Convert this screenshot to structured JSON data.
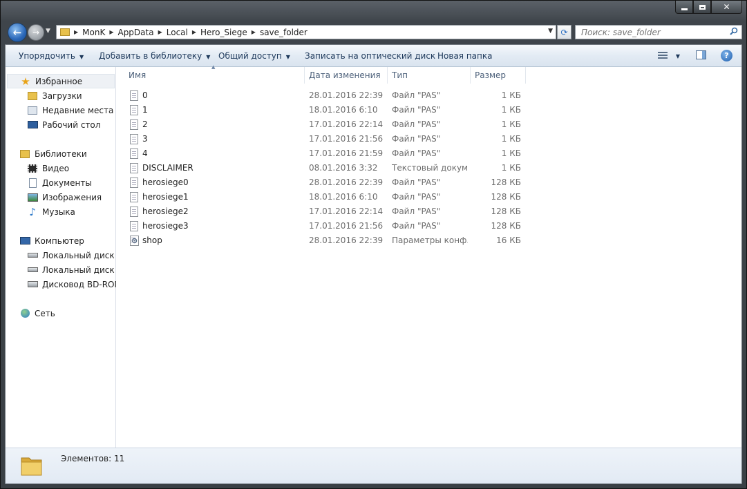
{
  "window": {
    "minimize_label": "_",
    "maximize_label": "□",
    "close_label": "✕"
  },
  "address": {
    "crumbs": [
      "MonK",
      "AppData",
      "Local",
      "Hero_Siege",
      "save_folder"
    ]
  },
  "search": {
    "placeholder": "Поиск: save_folder"
  },
  "toolbar": {
    "organize": "Упорядочить",
    "add_to_library": "Добавить в библиотеку",
    "share": "Общий доступ",
    "burn": "Записать на оптический диск",
    "new_folder": "Новая папка"
  },
  "sidebar": {
    "favorites": "Избранное",
    "downloads": "Загрузки",
    "recent": "Недавние места",
    "desktop": "Рабочий стол",
    "libraries": "Библиотеки",
    "video": "Видео",
    "documents": "Документы",
    "images": "Изображения",
    "music": "Музыка",
    "computer": "Компьютер",
    "disk_c": "Локальный диск (C",
    "disk_d": "Локальный диск (D",
    "bdrom": "Дисковод BD-ROM",
    "network": "Сеть"
  },
  "columns": {
    "name": "Имя",
    "date": "Дата изменения",
    "type": "Тип",
    "size": "Размер"
  },
  "files": [
    {
      "name": "0",
      "date": "28.01.2016 22:39",
      "type": "Файл \"PAS\"",
      "size": "1 КБ",
      "icon": "file-icon"
    },
    {
      "name": "1",
      "date": "18.01.2016 6:10",
      "type": "Файл \"PAS\"",
      "size": "1 КБ",
      "icon": "file-icon"
    },
    {
      "name": "2",
      "date": "17.01.2016 22:14",
      "type": "Файл \"PAS\"",
      "size": "1 КБ",
      "icon": "file-icon"
    },
    {
      "name": "3",
      "date": "17.01.2016 21:56",
      "type": "Файл \"PAS\"",
      "size": "1 КБ",
      "icon": "file-icon"
    },
    {
      "name": "4",
      "date": "17.01.2016 21:59",
      "type": "Файл \"PAS\"",
      "size": "1 КБ",
      "icon": "file-icon"
    },
    {
      "name": "DISCLAIMER",
      "date": "08.01.2016 3:32",
      "type": "Текстовый докум...",
      "size": "1 КБ",
      "icon": "text-file-icon"
    },
    {
      "name": "herosiege0",
      "date": "28.01.2016 22:39",
      "type": "Файл \"PAS\"",
      "size": "128 КБ",
      "icon": "file-icon"
    },
    {
      "name": "herosiege1",
      "date": "18.01.2016 6:10",
      "type": "Файл \"PAS\"",
      "size": "128 КБ",
      "icon": "file-icon"
    },
    {
      "name": "herosiege2",
      "date": "17.01.2016 22:14",
      "type": "Файл \"PAS\"",
      "size": "128 КБ",
      "icon": "file-icon"
    },
    {
      "name": "herosiege3",
      "date": "17.01.2016 21:56",
      "type": "Файл \"PAS\"",
      "size": "128 КБ",
      "icon": "file-icon"
    },
    {
      "name": "shop",
      "date": "28.01.2016 22:39",
      "type": "Параметры конф...",
      "size": "16 КБ",
      "icon": "config-file-icon"
    }
  ],
  "status": {
    "count": "Элементов: 11"
  }
}
